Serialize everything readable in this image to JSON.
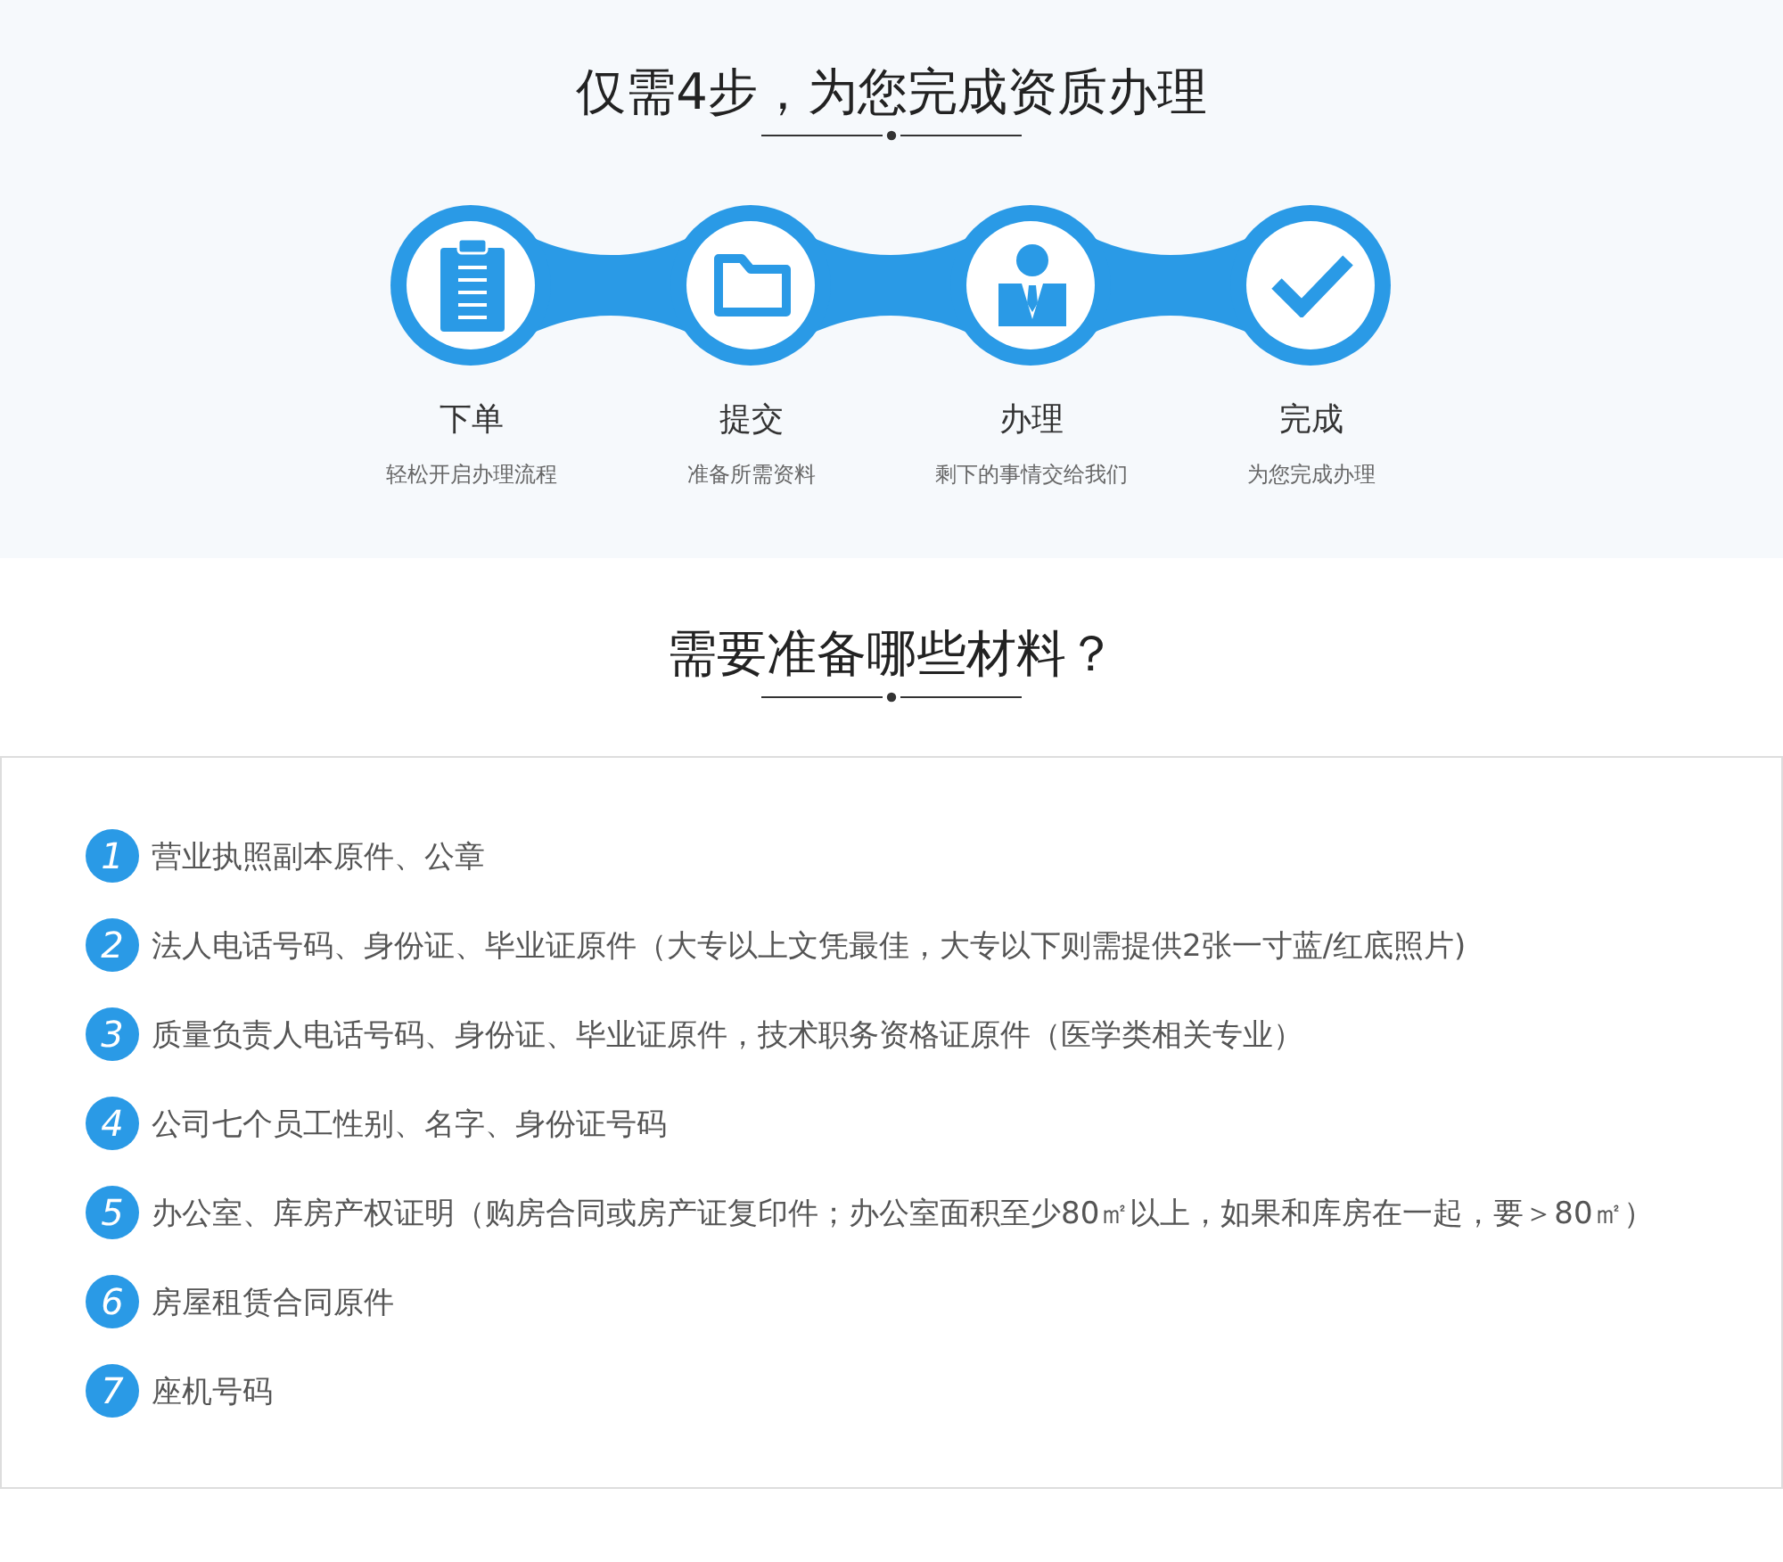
{
  "process": {
    "title": "仅需4步，为您完成资质办理",
    "steps": [
      {
        "kind": "clipboard",
        "title": "下单",
        "description": "轻松开启办理流程"
      },
      {
        "kind": "folder",
        "title": "提交",
        "description": "准备所需资料"
      },
      {
        "kind": "person",
        "title": "办理",
        "description": "剩下的事情交给我们"
      },
      {
        "kind": "check",
        "title": "完成",
        "description": "为您完成办理"
      }
    ]
  },
  "materials": {
    "title": "需要准备哪些材料？",
    "items": [
      {
        "number": "1",
        "text": "营业执照副本原件、公章"
      },
      {
        "number": "2",
        "text": "法人电话号码、身份证、毕业证原件（大专以上文凭最佳，大专以下则需提供2张一寸蓝/红底照片)"
      },
      {
        "number": "3",
        "text": "质量负责人电话号码、身份证、毕业证原件，技术职务资格证原件（医学类相关专业）"
      },
      {
        "number": "4",
        "text": "公司七个员工性别、名字、身份证号码"
      },
      {
        "number": "5",
        "text": "办公室、库房产权证明（购房合同或房产证复印件；办公室面积至少80㎡以上，如果和库房在一起，要＞80㎡）"
      },
      {
        "number": "6",
        "text": "房屋租赁合同原件"
      },
      {
        "number": "7",
        "text": "座机号码"
      }
    ]
  }
}
